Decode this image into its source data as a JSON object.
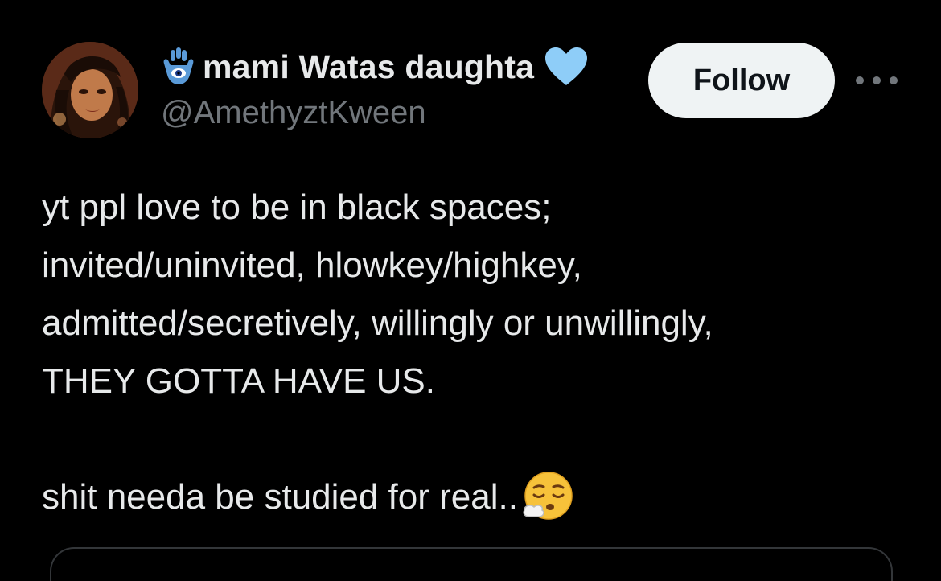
{
  "author": {
    "display_name": "mami Watas daughta",
    "handle": "@AmethyztKween",
    "name_prefix_icon": "hamsa-icon",
    "verified_icon": "blue-heart-icon",
    "avatar": "profile-avatar"
  },
  "actions": {
    "follow_label": "Follow",
    "more_icon": "more-options-icon"
  },
  "tweet": {
    "lines": [
      "yt ppl love to be in black spaces;",
      "invited/uninvited, hlowkey/highkey,",
      "admitted/secretively, willingly or unwillingly,",
      "THEY GOTTA HAVE US."
    ],
    "closing_line": "shit needa be studied for real..",
    "closing_emoji": "relieved-sigh-emoji"
  },
  "colors": {
    "background": "#000000",
    "text_primary": "#e7e9ea",
    "text_secondary": "#71767b",
    "follow_button_bg": "#eff3f4",
    "heart": "#8ecdf8"
  }
}
